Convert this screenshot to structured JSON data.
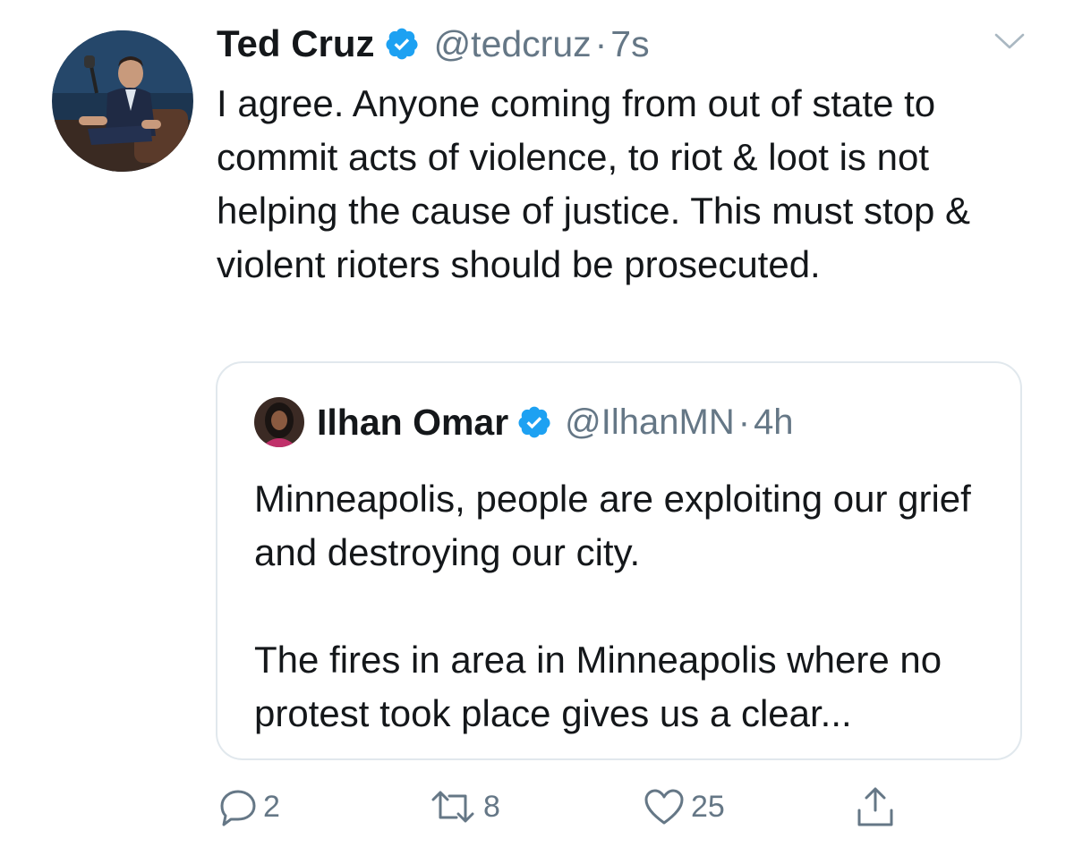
{
  "tweet": {
    "author_name": "Ted Cruz",
    "handle": "@tedcruz",
    "separator": "·",
    "time": "7s",
    "text": "I agree. Anyone coming from out of state to commit acts of violence, to riot & loot is not helping the cause of justice. This must stop & violent rioters should be prosecuted."
  },
  "quoted": {
    "author_name": "Ilhan Omar",
    "handle": "@IlhanMN",
    "separator": "·",
    "time": "4h",
    "paragraph_1": "Minneapolis, people are exploiting our grief and destroying our city.",
    "paragraph_2": "The fires in area in Minneapolis where no protest took place gives us a clear..."
  },
  "actions": {
    "reply_count": "2",
    "retweet_count": "8",
    "like_count": "25"
  },
  "icons": {
    "verified": "verified-badge-icon",
    "caret": "chevron-down-icon",
    "reply": "reply-icon",
    "retweet": "retweet-icon",
    "like": "heart-icon",
    "share": "share-icon"
  },
  "colors": {
    "text": "#14171a",
    "secondary": "#657786",
    "verified": "#1da1f2",
    "border": "#e1e8ed"
  }
}
